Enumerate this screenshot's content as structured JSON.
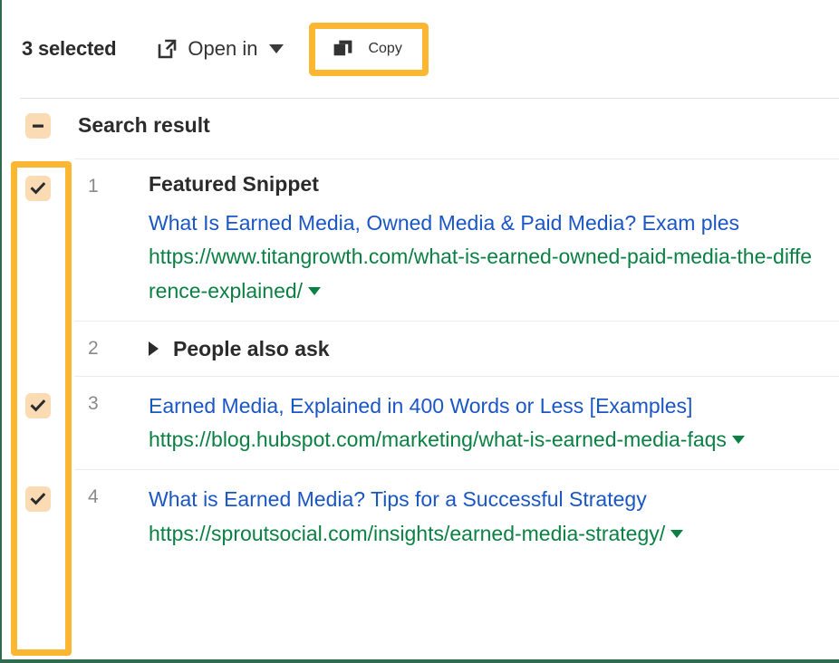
{
  "toolbar": {
    "selected_count_label": "3 selected",
    "open_in_label": "Open in",
    "copy_label": "Copy",
    "icons": {
      "open_in": "external-link-icon",
      "open_in_caret": "chevron-down-icon",
      "copy": "copy-icon"
    }
  },
  "table": {
    "header": {
      "checkbox_state": "indeterminate",
      "column_label": "Search result"
    },
    "rows": [
      {
        "position": "1",
        "selected": true,
        "kind": "Featured Snippet",
        "title": "What Is Earned Media, Owned Media & Paid Media? Exam ples",
        "url": "https://www.titangrowth.com/what-is-earned-owned-paid-media-the-difference-explained/"
      },
      {
        "position": "2",
        "selected": false,
        "kind": "People also ask",
        "title": "",
        "url": ""
      },
      {
        "position": "3",
        "selected": true,
        "kind": "",
        "title": "Earned Media, Explained in 400 Words or Less [Examples]",
        "url": "https://blog.hubspot.com/marketing/what-is-earned-media-faqs"
      },
      {
        "position": "4",
        "selected": true,
        "kind": "",
        "title": "What is Earned Media? Tips for a Successful Strategy",
        "url": "https://sproutsocial.com/insights/earned-media-strategy/"
      }
    ]
  },
  "colors": {
    "highlight": "#fbb731",
    "checkbox_fill": "#fadbb4",
    "link_blue": "#1a56c4",
    "url_green": "#0b8043",
    "text_dark": "#2b2b2b",
    "number_gray": "#8a8a8a",
    "page_border_green": "#2f6b4f"
  }
}
